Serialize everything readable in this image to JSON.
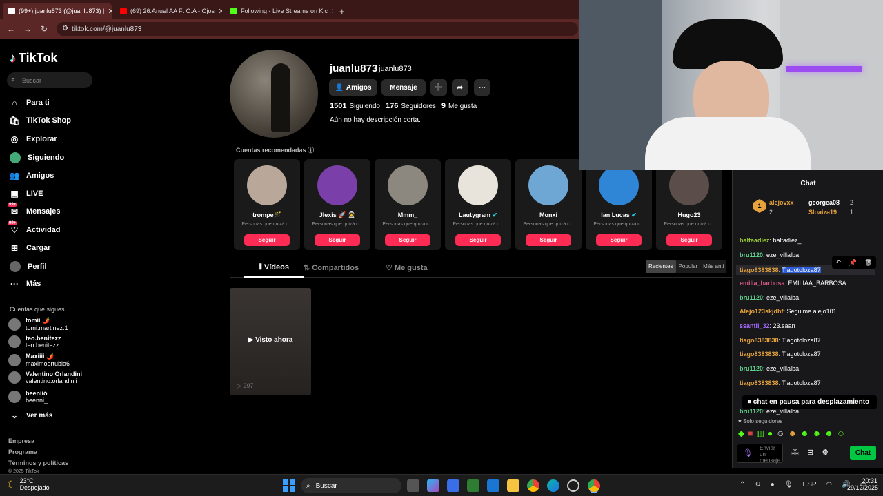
{
  "browser": {
    "tabs": [
      {
        "title": "(99+) juanlu873 (@juanlu873) |",
        "favicon_color": "#ffffff"
      },
      {
        "title": "(69) 26.Anuel AA Ft O.A - Ojos",
        "favicon_color": "#ff0000"
      },
      {
        "title": "Following - Live Streams on Kic",
        "favicon_color": "#53fc18"
      }
    ],
    "new_tab": "+",
    "url": "tiktok.com/@juanlu873"
  },
  "sidebar": {
    "logo": "TikTok",
    "search_placeholder": "Buscar",
    "nav": [
      {
        "label": "Para ti",
        "icon": "home-icon"
      },
      {
        "label": "TikTok Shop",
        "icon": "shop-icon"
      },
      {
        "label": "Explorar",
        "icon": "compass-icon"
      },
      {
        "label": "Siguiendo",
        "icon": "following-icon"
      },
      {
        "label": "Amigos",
        "icon": "friends-icon"
      },
      {
        "label": "LIVE",
        "icon": "live-icon"
      },
      {
        "label": "Mensajes",
        "icon": "message-icon",
        "badge": "99+"
      },
      {
        "label": "Actividad",
        "icon": "activity-icon",
        "badge": "99+"
      },
      {
        "label": "Cargar",
        "icon": "upload-icon"
      },
      {
        "label": "Perfil",
        "icon": "profile-icon"
      },
      {
        "label": "Más",
        "icon": "more-icon"
      }
    ],
    "following_title": "Cuentas que sigues",
    "following": [
      {
        "name": "tomii 🌶️",
        "handle": "tomi.martinez.1"
      },
      {
        "name": "teo.benitezz",
        "handle": "teo.benitezz"
      },
      {
        "name": "Maxiiii 🌶️",
        "handle": "maximoortubia6"
      },
      {
        "name": "Valentino Orlandini",
        "handle": "valentino.orlandinii"
      },
      {
        "name": "beeniiō",
        "handle": "beenni_"
      }
    ],
    "see_more": "Ver más",
    "footer": [
      "Empresa",
      "Programa",
      "Términos y políticas",
      "© 2025 TikTok"
    ]
  },
  "profile": {
    "display_name": "juanlu873",
    "username": "juanlu873",
    "btn_friends": "Amigos",
    "btn_message": "Mensaje",
    "following_count": "1501",
    "following_label": "Siguiendo",
    "followers_count": "176",
    "followers_label": "Seguidores",
    "likes_count": "9",
    "likes_label": "Me gusta",
    "bio": "Aún no hay descripción corta.",
    "recommended_title": "Cuentas recomendadas",
    "recommended": [
      {
        "name": "trompe🪄",
        "sub": "Personas que quizá c...",
        "follow": "Seguir",
        "color": "#b9a89a"
      },
      {
        "name": "Jlexis 🚀 👨‍🚀",
        "sub": "Personas que quizá c...",
        "follow": "Seguir",
        "color": "#7a3fa8"
      },
      {
        "name": "Mmm_",
        "sub": "Personas que quizá c...",
        "follow": "Seguir",
        "color": "#8c877f"
      },
      {
        "name": "Lautygram",
        "sub": "Personas que quizá c...",
        "follow": "Seguir",
        "color": "#e8e4dc"
      },
      {
        "name": "Monxi",
        "sub": "Personas que quizá c...",
        "follow": "Seguir",
        "color": "#6ea7d4"
      },
      {
        "name": "Ian Lucas",
        "sub": "Personas que quizá c...",
        "follow": "Seguir",
        "color": "#2f86d6"
      },
      {
        "name": "Hugo23",
        "sub": "Personas que quizá c...",
        "follow": "Seguir",
        "color": "#5b4e4a"
      }
    ],
    "tabs": [
      "Vídeos",
      "Compartidos",
      "Me gusta"
    ],
    "sort": [
      "Recientes",
      "Popular",
      "Más anti"
    ],
    "video_label": "Visto ahora",
    "video_views": "297"
  },
  "chat": {
    "title": "Chat",
    "leaders": [
      {
        "rank": "1",
        "name": "alejovxx",
        "count": "2"
      },
      {
        "rank": "",
        "name": "georgea08",
        "count": "2"
      },
      {
        "rank": "",
        "name": "Sloaiza19",
        "count": "1"
      }
    ],
    "messages": [
      {
        "user": "baltaadiez",
        "text": "baltadiez_",
        "color": "#9acd32"
      },
      {
        "user": "bru1120",
        "text": "eze_villalba",
        "color": "#5fd38d"
      },
      {
        "user": "tiago8383838",
        "text": "Tiagotoloza87",
        "color": "#e6a23c"
      },
      {
        "user": "emilia_barbosa",
        "text": "EMILIAA_BARBOSA",
        "color": "#e05a8a"
      },
      {
        "user": "bru1120",
        "text": "eze_villalba",
        "color": "#5fd38d"
      },
      {
        "user": "Alejo123skjdhf",
        "text": "Seguime alejo101",
        "color": "#e6a23c"
      },
      {
        "user": "ssantii_32",
        "text": "23.saan",
        "color": "#a86bff"
      },
      {
        "user": "tiago8383838",
        "text": "Tiagotoloza87",
        "color": "#e6a23c"
      },
      {
        "user": "tiago8383838",
        "text": "Tiagotoloza87",
        "color": "#e6a23c"
      },
      {
        "user": "bru1120",
        "text": "eze_villalba",
        "color": "#5fd38d"
      },
      {
        "user": "tiago8383838",
        "text": "Tiagotoloza87",
        "color": "#e6a23c"
      },
      {
        "user": "bru1120",
        "text": "eze_villalba",
        "color": "#5fd38d"
      }
    ],
    "paused": "chat en pausa para desplazamiento",
    "followers_only": "Solo seguidores",
    "input_placeholder": "Enviar un mensaje",
    "send_button": "Chat"
  },
  "taskbar": {
    "weather_temp": "23°C",
    "weather_desc": "Despejado",
    "search": "Buscar",
    "lang": "ESP",
    "time": "20:31",
    "date": "29/12/2025"
  }
}
